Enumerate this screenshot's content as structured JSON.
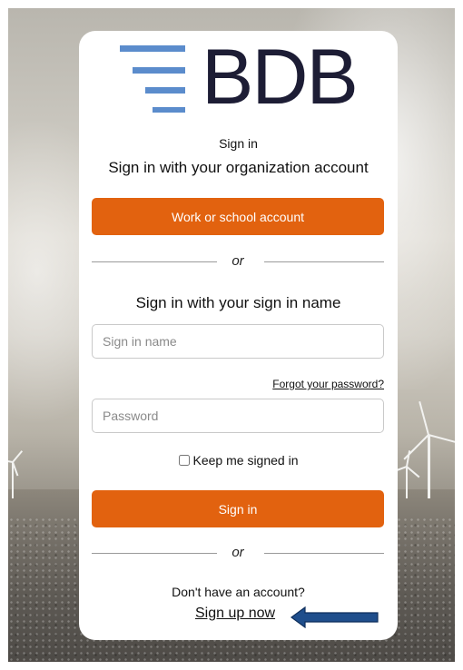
{
  "brand": {
    "logo_text": "BDB",
    "logo_bar_color": "#5b8ccc",
    "logo_text_color": "#1d1d35"
  },
  "header": {
    "sign_in_label": "Sign in",
    "org_prompt": "Sign in with your organization account"
  },
  "work_account_button": {
    "label": "Work or school account",
    "color": "#e2620f"
  },
  "divider": {
    "text": "or"
  },
  "local_signin": {
    "title": "Sign in with your sign in name",
    "name_placeholder": "Sign in name",
    "forgot_password_link": "Forgot your password?",
    "password_placeholder": "Password",
    "keep_signed_in_label": "Keep me signed in",
    "keep_signed_in_checked": false,
    "submit_label": "Sign in"
  },
  "signup": {
    "prompt": "Don't have an account?",
    "link_label": "Sign up now"
  },
  "annotation": {
    "arrow_color": "#1f4e8c",
    "arrow_icon": "left-arrow-icon"
  }
}
